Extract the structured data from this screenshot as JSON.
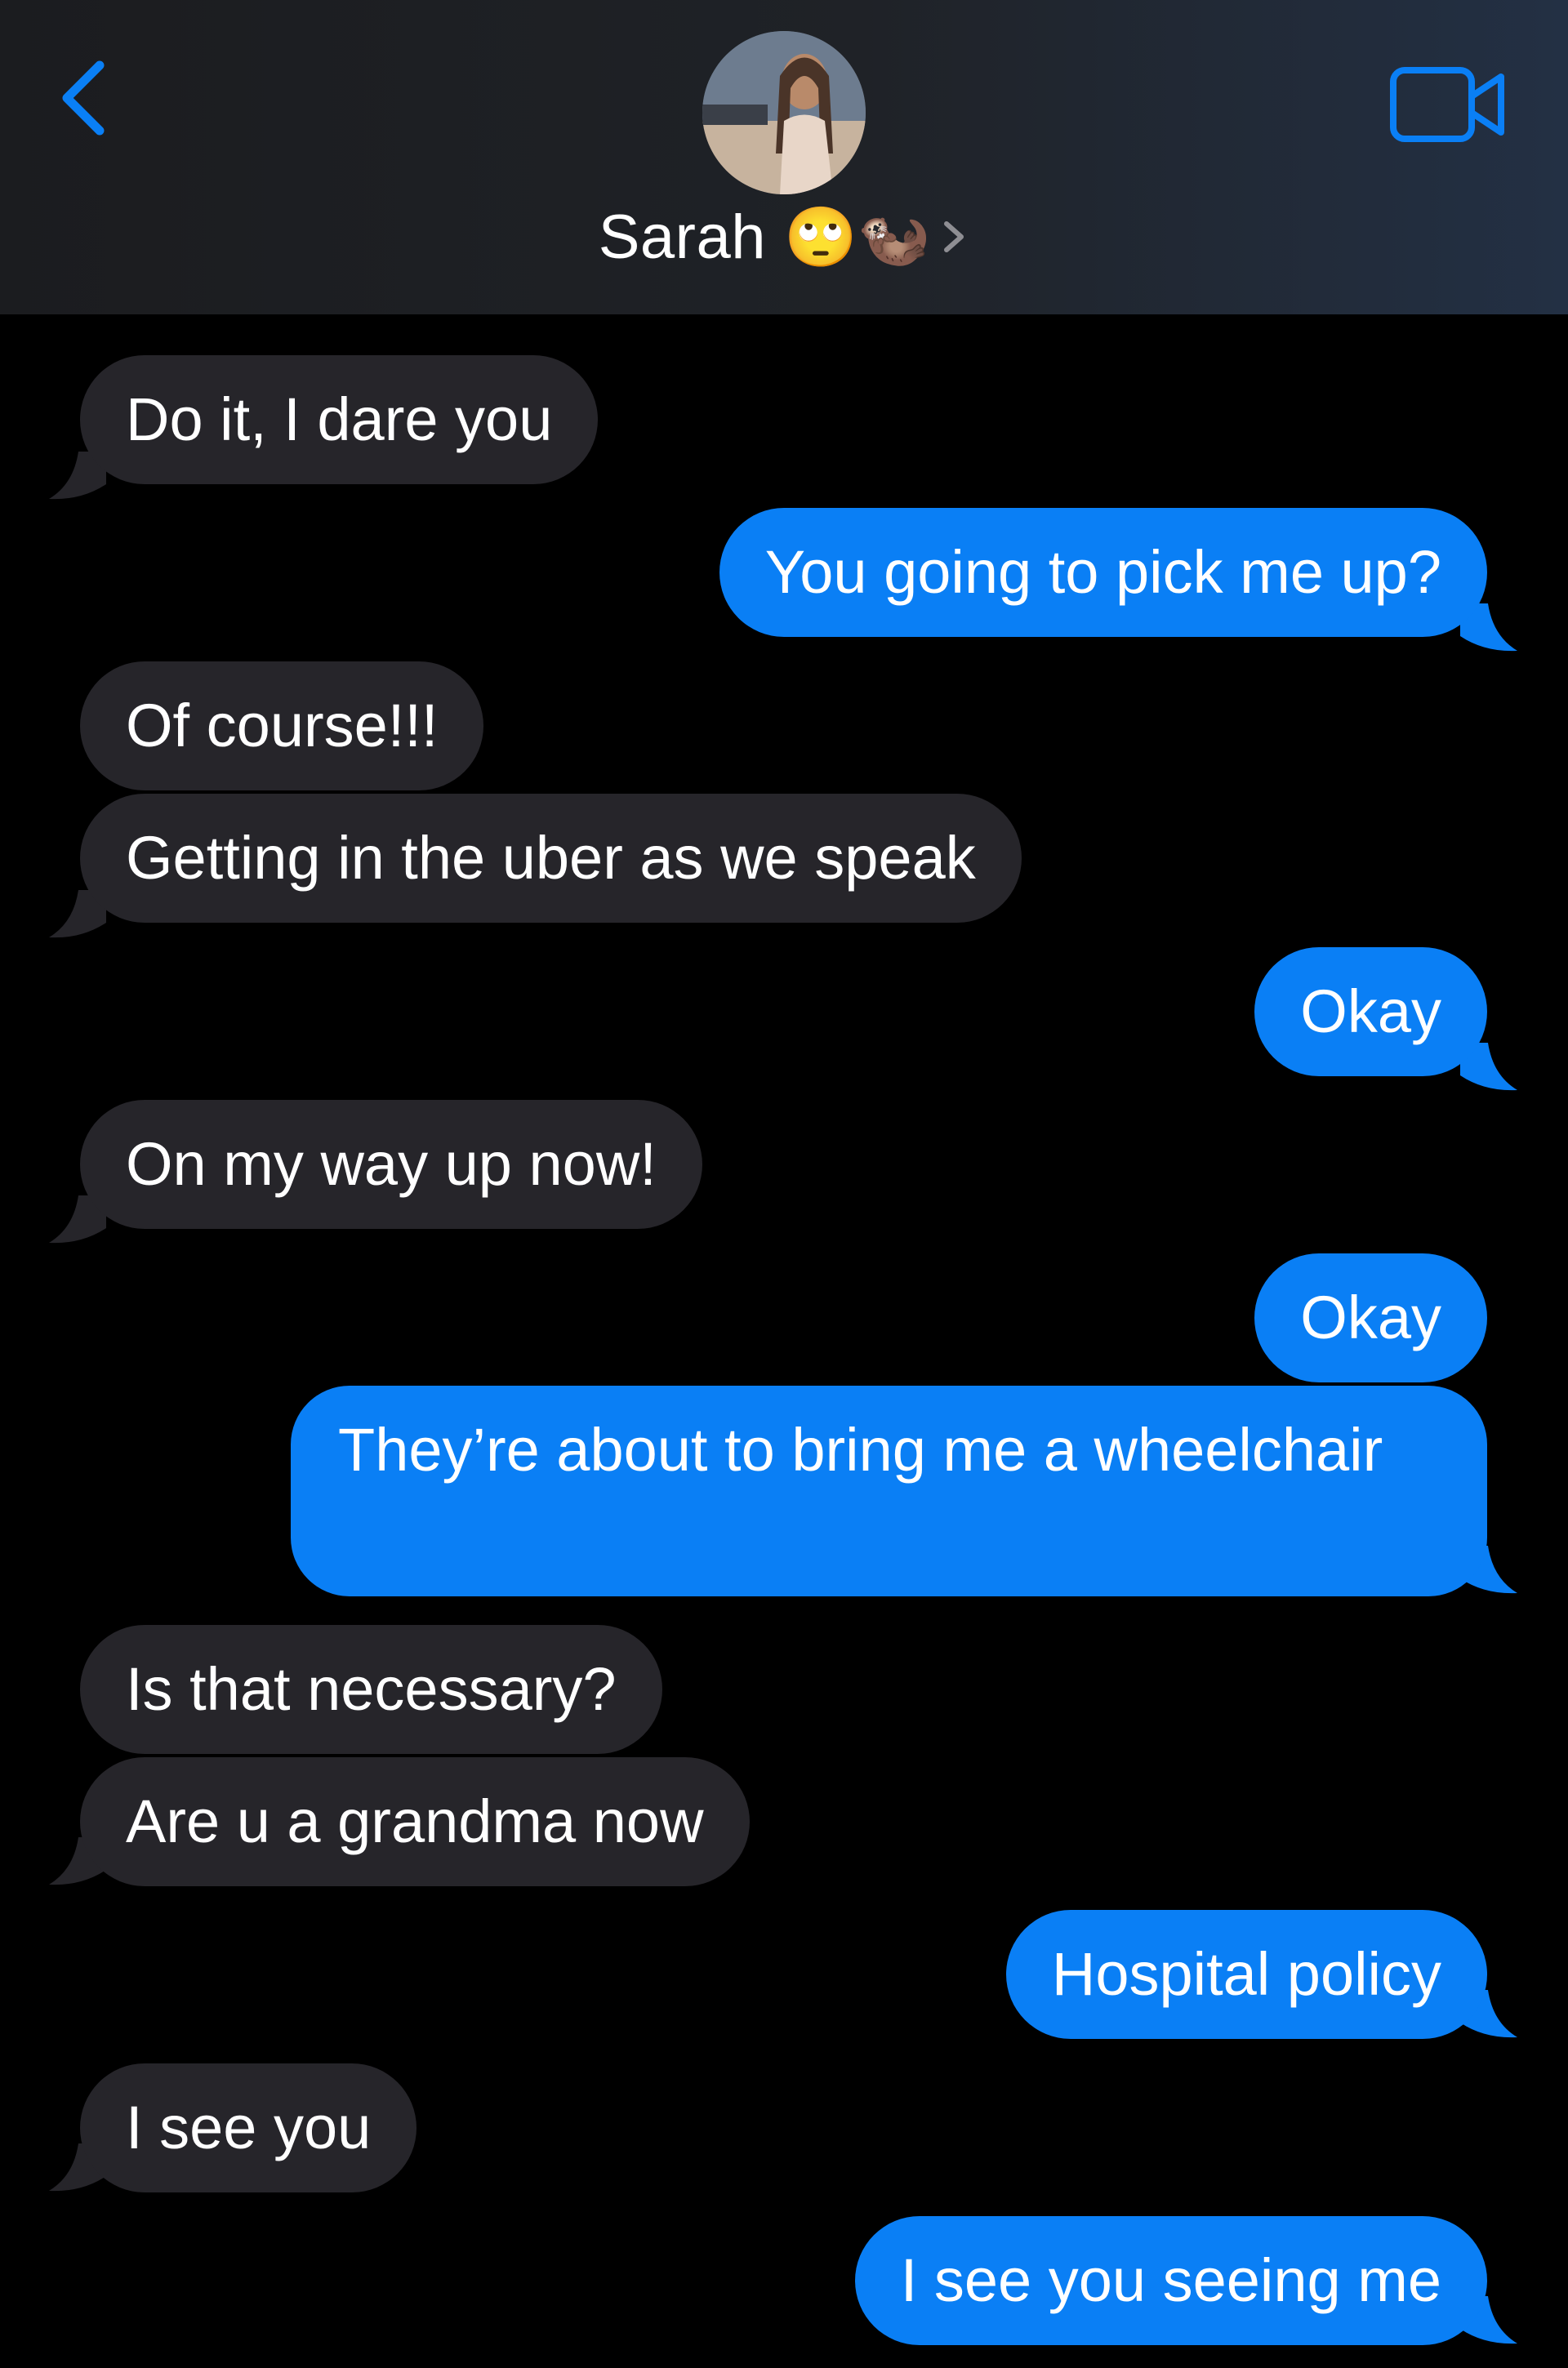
{
  "header": {
    "contact_name": "Sarah",
    "contact_emoji": "🙄🦦",
    "back_icon": "chevron-left-icon",
    "video_icon": "video-camera-icon",
    "accent_color": "#0a7ff5"
  },
  "messages": [
    {
      "from": "them",
      "text": "Do it, I dare you"
    },
    {
      "from": "me",
      "text": "You going to pick me up?"
    },
    {
      "from": "them",
      "text": "Of course!!!"
    },
    {
      "from": "them",
      "text": "Getting in the uber as we speak"
    },
    {
      "from": "me",
      "text": "Okay"
    },
    {
      "from": "them",
      "text": "On my way up now!"
    },
    {
      "from": "me",
      "text": "Okay"
    },
    {
      "from": "me",
      "text": "They’re about to bring me a wheelchair"
    },
    {
      "from": "them",
      "text": "Is that necessary?"
    },
    {
      "from": "them",
      "text": "Are u a grandma now"
    },
    {
      "from": "me",
      "text": "Hospital policy"
    },
    {
      "from": "them",
      "text": "I see you"
    },
    {
      "from": "me",
      "text": "I see you seeing me"
    }
  ],
  "colors": {
    "received_bubble": "#26252a",
    "sent_bubble": "#0a7ff5",
    "background": "#000000"
  }
}
